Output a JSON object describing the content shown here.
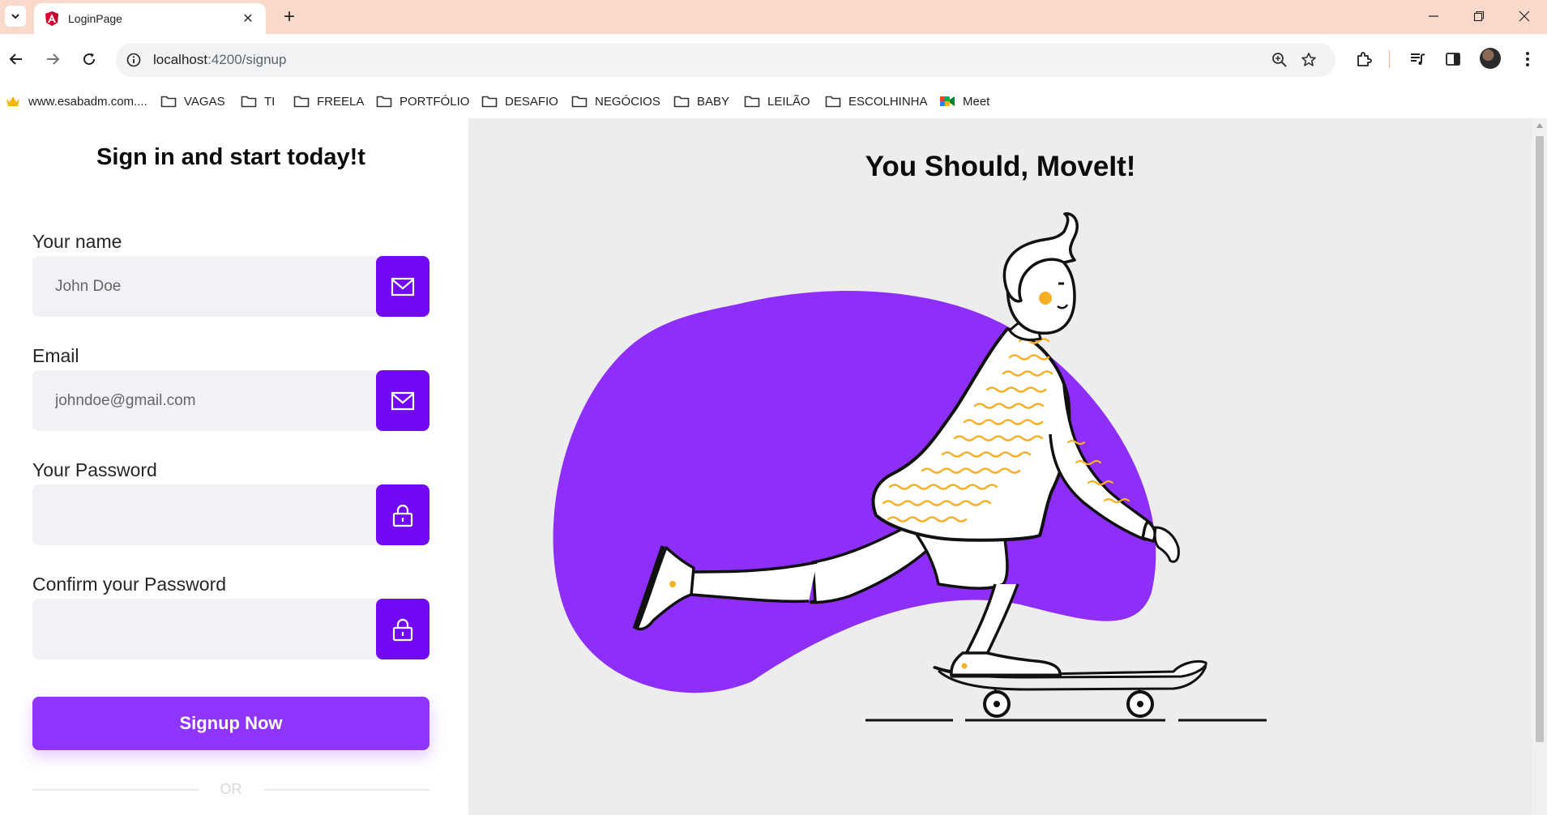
{
  "browser": {
    "tab_title": "LoginPage",
    "new_tab_symbol": "+",
    "url_host": "localhost",
    "url_path": ":4200/signup",
    "icons": [
      "tab-search-icon",
      "angular-favicon-icon",
      "close-icon",
      "new-tab-icon",
      "back-icon",
      "forward-icon",
      "reload-icon",
      "site-info-icon",
      "zoom-icon",
      "bookmark-star-icon",
      "extensions-icon",
      "media-control-icon",
      "side-panel-icon",
      "avatar",
      "menu-icon",
      "minimize-icon",
      "restore-icon",
      "window-close-icon"
    ]
  },
  "bookmarks": [
    {
      "label": "www.esabadm.com....",
      "icon": "crown-icon"
    },
    {
      "label": "VAGAS",
      "icon": "folder-icon"
    },
    {
      "label": "TI",
      "icon": "folder-icon"
    },
    {
      "label": "FREELA",
      "icon": "folder-icon"
    },
    {
      "label": "PORTFÓLIO",
      "icon": "folder-icon"
    },
    {
      "label": "DESAFIO",
      "icon": "folder-icon"
    },
    {
      "label": "NEGÓCIOS",
      "icon": "folder-icon"
    },
    {
      "label": "BABY",
      "icon": "folder-icon"
    },
    {
      "label": "LEILÃO",
      "icon": "folder-icon"
    },
    {
      "label": "ESCOLHINHA",
      "icon": "folder-icon"
    },
    {
      "label": "Meet",
      "icon": "meet-icon"
    }
  ],
  "form": {
    "title": "Sign in and start today!t",
    "fields": [
      {
        "label": "Your name",
        "placeholder": "John Doe",
        "icon": "mail-icon"
      },
      {
        "label": "Email",
        "placeholder": "johndoe@gmail.com",
        "icon": "mail-icon"
      },
      {
        "label": "Your Password",
        "placeholder": "",
        "icon": "lock-icon"
      },
      {
        "label": "Confirm your Password",
        "placeholder": "",
        "icon": "lock-icon"
      }
    ],
    "submit_label": "Signup Now",
    "divider_text": "OR"
  },
  "hero": {
    "title": "You Should, MoveIt!",
    "illustration": "skateboarder-illustration"
  },
  "colors": {
    "titlebar": "#f9d9c9",
    "accent": "#7209f5",
    "button": "#8f35ff",
    "blob": "#8d2ff8",
    "sweater_stripes": "#f5b026",
    "right_panel": "#ededed"
  }
}
